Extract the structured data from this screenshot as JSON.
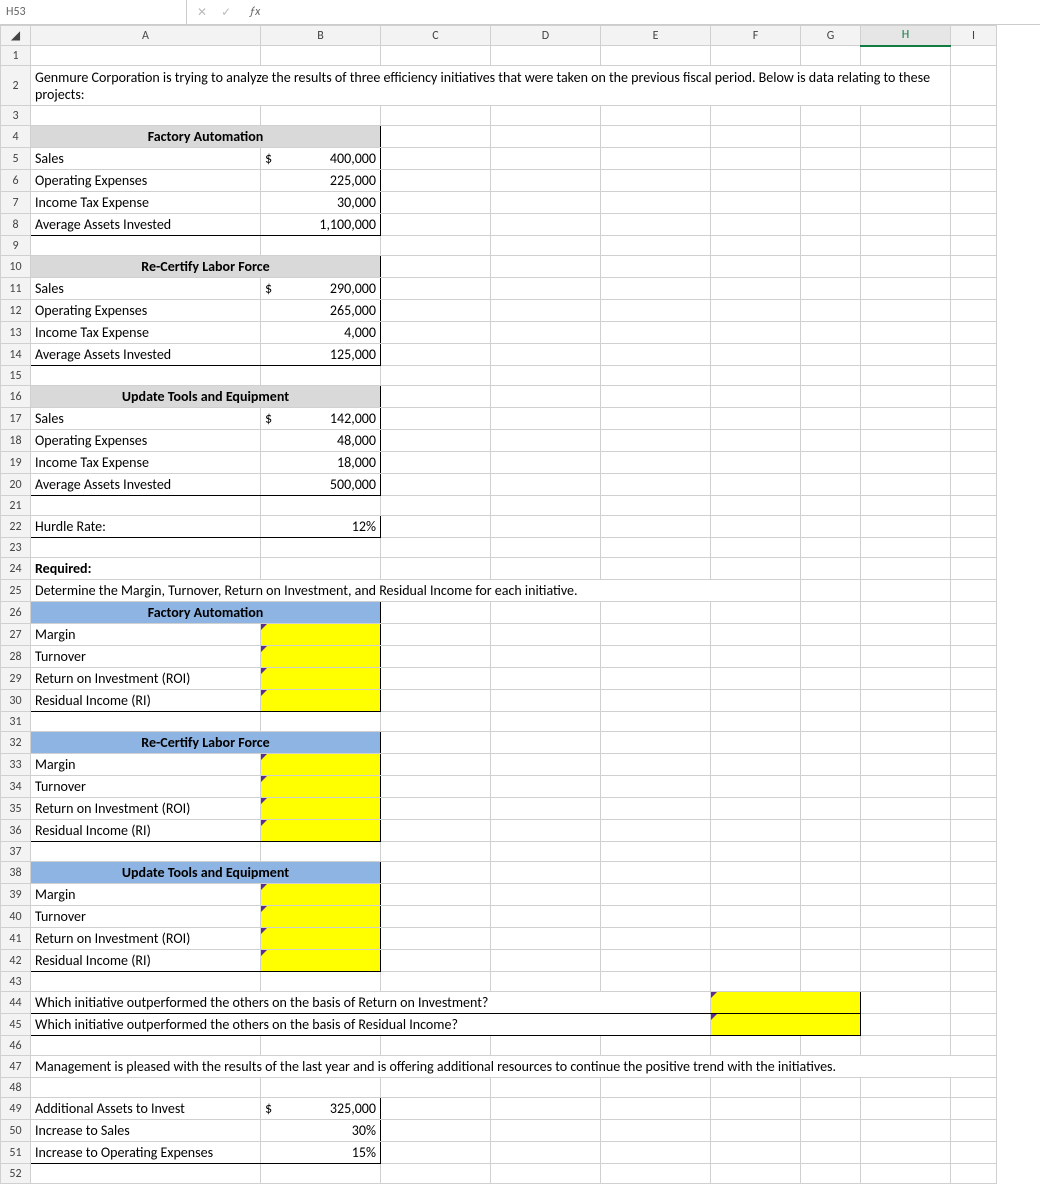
{
  "formula_bar": {
    "cell_ref": "H53",
    "fx": "ƒx"
  },
  "columns": [
    "A",
    "B",
    "C",
    "D",
    "E",
    "F",
    "G",
    "H",
    "I"
  ],
  "active_column": "H",
  "row_count": 52,
  "text": {
    "r2": "Genmure Corporation is trying to analyze the results of three efficiency initiatives that were taken on the previous fiscal period. Below is data relating to these projects:",
    "factory_automation": "Factory Automation",
    "recertify": "Re-Certify Labor Force",
    "tools": "Update Tools and Equipment",
    "sales": "Sales",
    "opex": "Operating Expenses",
    "tax": "Income Tax Expense",
    "assets": "Average Assets Invested",
    "hurdle": "Hurdle Rate:",
    "required": "Required:",
    "determine": "Determine the Margin, Turnover, Return on Investment, and Residual Income for each initiative.",
    "margin": "Margin",
    "turnover": "Turnover",
    "roi": "Return on Investment (ROI)",
    "ri": "Residual Income (RI)",
    "q_roi": "Which initiative outperformed the others on the basis of Return on Investment?",
    "q_ri": "Which initiative outperformed the others on the basis of Residual Income?",
    "mgmt": "Management is pleased with the results of the last year and is offering additional resources to continue the positive trend with the initiatives.",
    "add_assets": "Additional Assets to Invest",
    "inc_sales": "Increase to Sales",
    "inc_opex": "Increase to Operating Expenses"
  },
  "values": {
    "fa_sales": "400,000",
    "fa_opex": "225,000",
    "fa_tax": "30,000",
    "fa_assets": "1,100,000",
    "rc_sales": "290,000",
    "rc_opex": "265,000",
    "rc_tax": "4,000",
    "rc_assets": "125,000",
    "te_sales": "142,000",
    "te_opex": "48,000",
    "te_tax": "18,000",
    "te_assets": "500,000",
    "hurdle": "12%",
    "add_assets": "325,000",
    "inc_sales": "30%",
    "inc_opex": "15%"
  }
}
